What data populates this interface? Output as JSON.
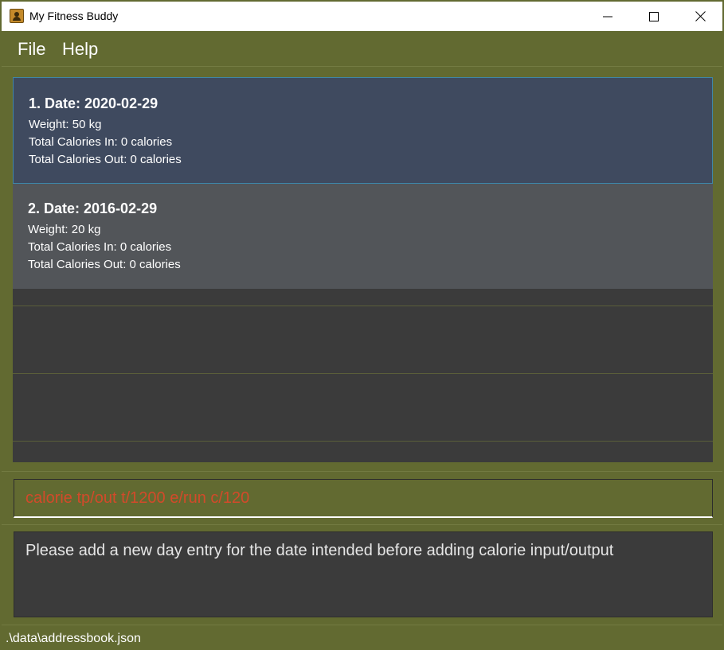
{
  "window": {
    "title": "My Fitness Buddy"
  },
  "menu": {
    "file": "File",
    "help": "Help"
  },
  "days": [
    {
      "heading": "1.  Date: 2020-02-29",
      "weight": "Weight: 50 kg",
      "calories_in": "Total Calories In: 0 calories",
      "calories_out": "Total Calories Out: 0 calories"
    },
    {
      "heading": "2.  Date: 2016-02-29",
      "weight": "Weight: 20 kg",
      "calories_in": "Total Calories In: 0 calories",
      "calories_out": "Total Calories Out: 0 calories"
    }
  ],
  "command": {
    "value": "calorie tp/out t/1200 e/run c/120"
  },
  "result": {
    "message": "Please add a new day entry for the date intended before adding calorie input/output"
  },
  "status": {
    "file_path": ".\\data\\addressbook.json"
  },
  "colors": {
    "background": "#626a31",
    "selected_card": "#3f4a5f",
    "card": "#525559",
    "list_bg": "#3b3b3b",
    "error_text": "#d24a2a"
  }
}
